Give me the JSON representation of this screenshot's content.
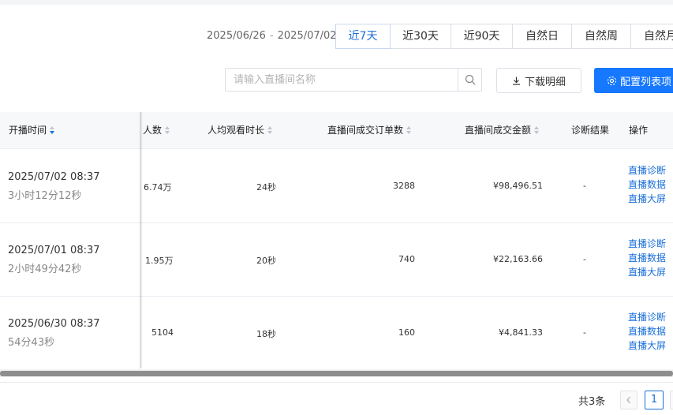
{
  "date_range": {
    "start": "2025/06/26",
    "separator": "-",
    "end": "2025/07/02"
  },
  "period_tabs": [
    "近7天",
    "近30天",
    "近90天",
    "自然日",
    "自然周",
    "自然月"
  ],
  "active_period": "近7天",
  "search": {
    "placeholder": "请输入直播间名称",
    "value": ""
  },
  "buttons": {
    "download": "下载明细",
    "config": "配置列表项"
  },
  "icons": {
    "search": "search-icon",
    "download": "download-icon",
    "config": "gear-icon",
    "sort": "sort-caret-icon",
    "prev": "chevron-left-icon"
  },
  "colors": {
    "accent": "#1677ff",
    "link": "#1a6fd8"
  },
  "table": {
    "columns": {
      "start_time": "开播时间",
      "viewers": "人数",
      "avg_watch": "人均观看时长",
      "orders": "直播间成交订单数",
      "gmv": "直播间成交金额",
      "diagnosis": "诊断结果",
      "actions": "操作"
    },
    "sort": {
      "column": "开播时间",
      "direction": "desc"
    },
    "rows": [
      {
        "start": "2025/07/02 08:37",
        "duration": "3小时12分12秒",
        "viewers": "6.74万",
        "avg_watch": "24秒",
        "orders": "3288",
        "gmv": "¥98,496.51",
        "diagnosis": "-",
        "actions": [
          "直播诊断",
          "直播数据",
          "直播大屏"
        ]
      },
      {
        "start": "2025/07/01 08:37",
        "duration": "2小时49分42秒",
        "viewers": "1.95万",
        "avg_watch": "20秒",
        "orders": "740",
        "gmv": "¥22,163.66",
        "diagnosis": "-",
        "actions": [
          "直播诊断",
          "直播数据",
          "直播大屏"
        ]
      },
      {
        "start": "2025/06/30 08:37",
        "duration": "54分43秒",
        "viewers": "5104",
        "avg_watch": "18秒",
        "orders": "160",
        "gmv": "¥4,841.33",
        "diagnosis": "-",
        "actions": [
          "直播诊断",
          "直播数据",
          "直播大屏"
        ]
      }
    ]
  },
  "pagination": {
    "total": "共3条",
    "current_page": "1"
  }
}
